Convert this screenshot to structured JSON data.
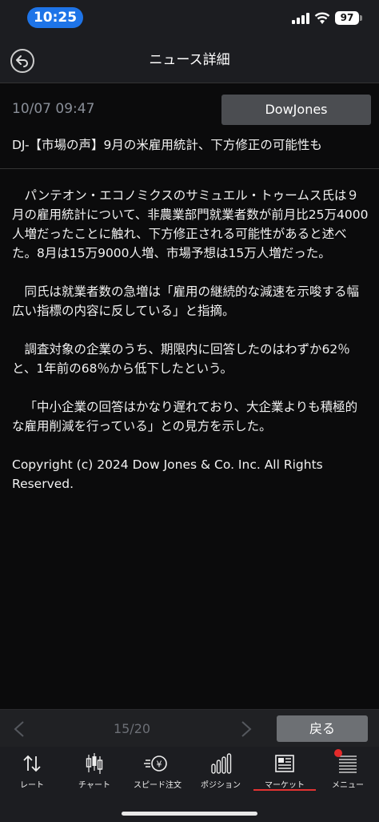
{
  "status_bar": {
    "time": "10:25",
    "battery": "97"
  },
  "header": {
    "title": "ニュース詳細"
  },
  "article": {
    "datetime": "10/07 09:47",
    "source": "DowJones",
    "headline": "DJ-【市場の声】9月の米雇用統計、下方修正の可能性も",
    "paragraphs": [
      "パンテオン・エコノミクスのサミュエル・トゥームス氏は９月の雇用統計について、非農業部門就業者数が前月比25万4000人増だったことに触れ、下方修正される可能性があると述べた。8月は15万9000人増、市場予想は15万人増だった。",
      "同氏は就業者数の急増は「雇用の継続的な減速を示唆する幅広い指標の内容に反している」と指摘。",
      "調査対象の企業のうち、期限内に回答したのはわずか62％と、1年前の68％から低下したという。",
      "「中小企業の回答はかなり遅れており、大企業よりも積極的な雇用削減を行っている」との見方を示した。"
    ],
    "copyright": "Copyright (c) 2024 Dow Jones & Co. Inc. All Rights Reserved."
  },
  "pager": {
    "indicator": "15/20",
    "back_label": "戻る"
  },
  "tabbar": {
    "active": "market",
    "items": [
      {
        "id": "rate",
        "label": "レート",
        "icon": "rate-arrows-icon"
      },
      {
        "id": "chart",
        "label": "チャート",
        "icon": "candlestick-icon"
      },
      {
        "id": "speed",
        "label": "スピード注文",
        "icon": "speed-order-icon"
      },
      {
        "id": "position",
        "label": "ポジション",
        "icon": "bar-chart-icon"
      },
      {
        "id": "market",
        "label": "マーケット",
        "icon": "newspaper-icon"
      },
      {
        "id": "menu",
        "label": "メニュー",
        "icon": "menu-list-icon"
      }
    ]
  },
  "colors": {
    "accent": "#1e74e8",
    "active_tab": "#e23232",
    "badge": "#e42a2a"
  }
}
